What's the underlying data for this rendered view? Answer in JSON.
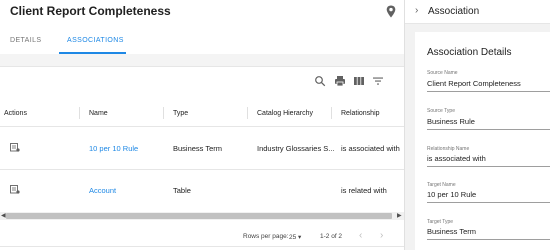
{
  "header": {
    "title": "Client Report Completeness"
  },
  "tabs": [
    {
      "label": "DETAILS"
    },
    {
      "label": "ASSOCIATIONS"
    }
  ],
  "table": {
    "columns": [
      "Actions",
      "Name",
      "Type",
      "Catalog Hierarchy",
      "Relationship"
    ],
    "rows": [
      {
        "name": "10 per 10 Rule",
        "type": "Business Term",
        "hierarchy": "Industry Glossaries S...",
        "relationship": "is associated with"
      },
      {
        "name": "Account",
        "type": "Table",
        "hierarchy": "",
        "relationship": "is related with"
      }
    ]
  },
  "footer": {
    "rows_per_page_label": "Rows per page:",
    "rows_per_page_value": "25",
    "range": "1-2 of 2"
  },
  "panel": {
    "title": "Association",
    "details_title": "Association Details",
    "fields": [
      {
        "label": "Source Name",
        "value": "Client Report Completeness"
      },
      {
        "label": "Source Type",
        "value": "Business Rule"
      },
      {
        "label": "Relationship Name",
        "value": "is associated with"
      },
      {
        "label": "Target Name",
        "value": "10 per 10 Rule"
      },
      {
        "label": "Target Type",
        "value": "Business Term"
      }
    ]
  },
  "colors": {
    "accent": "#1e88e5",
    "text": "#212121",
    "muted": "#757575"
  }
}
